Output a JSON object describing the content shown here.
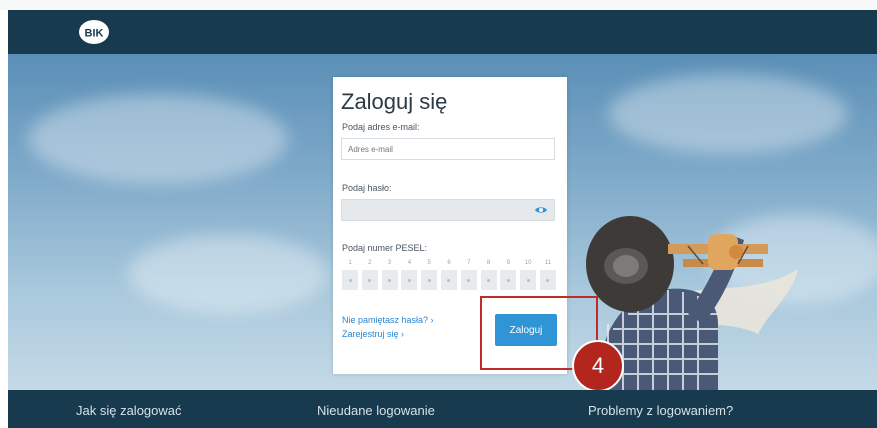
{
  "header": {
    "logo_text": "BIK"
  },
  "login": {
    "title": "Zaloguj się",
    "email_label": "Podaj adres e-mail:",
    "email_placeholder": "Adres e-mail",
    "password_label": "Podaj hasło:",
    "pesel_label": "Podaj numer PESEL:",
    "pesel_numbers": [
      "1",
      "2",
      "3",
      "4",
      "5",
      "6",
      "7",
      "8",
      "9",
      "10",
      "11"
    ],
    "forgot_link": "Nie pamiętasz hasła? ›",
    "register_link": "Zarejestruj się ›",
    "submit": "Zaloguj"
  },
  "annotation": {
    "step": "4",
    "color": "#b3261e"
  },
  "footer": {
    "items": [
      "Jak się zalogować",
      "Nieudane logowanie",
      "Problemy z logowaniem?"
    ]
  },
  "colors": {
    "header": "#173a4f",
    "accent": "#2f95d6"
  }
}
